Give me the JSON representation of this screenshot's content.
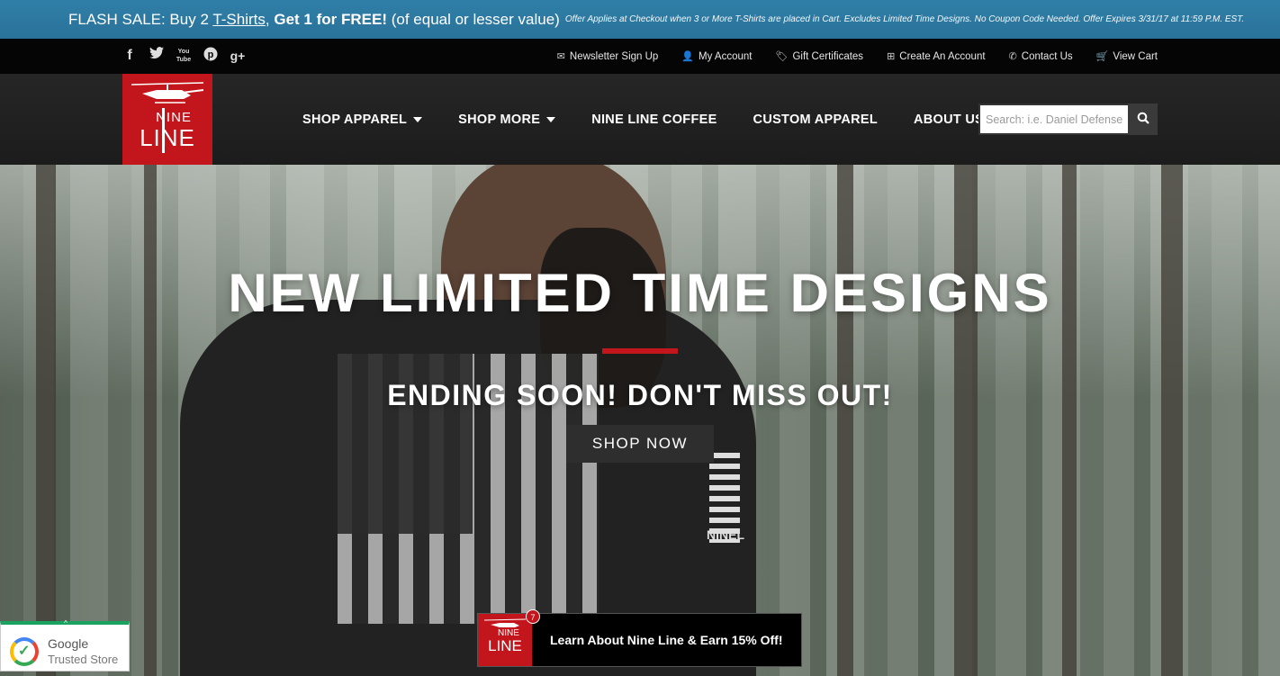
{
  "flash_banner": {
    "prefix": "FLASH SALE: Buy 2 ",
    "link": "T-Shirts",
    "comma": ",",
    "bold": "Get 1 for FREE!",
    "suffix": "(of equal or lesser value)",
    "fine_print": "Offer Applies at Checkout when 3 or More T-Shirts are placed in Cart. Excludes Limited Time Designs. No Coupon Code Needed. Offer Expires 3/31/17 at 11:59 P.M. EST."
  },
  "social": {
    "facebook": "f",
    "twitter": "t",
    "youtube": "You Tube",
    "pinterest": "p",
    "googleplus": "g+"
  },
  "utility_links": [
    {
      "label": "Newsletter Sign Up",
      "icon": "envelope-icon"
    },
    {
      "label": "My Account",
      "icon": "user-icon"
    },
    {
      "label": "Gift Certificates",
      "icon": "tag-icon"
    },
    {
      "label": "Create An Account",
      "icon": "plus-square-icon"
    },
    {
      "label": "Contact Us",
      "icon": "phone-icon"
    },
    {
      "label": "View Cart",
      "icon": "cart-icon"
    }
  ],
  "logo": {
    "line1": "NINE",
    "line2": "LINE"
  },
  "nav": [
    {
      "label": "SHOP APPAREL"
    },
    {
      "label": "SHOP MORE"
    },
    {
      "label": "NINE LINE COFFEE"
    },
    {
      "label": "CUSTOM APPAREL"
    },
    {
      "label": "ABOUT US"
    }
  ],
  "search": {
    "placeholder": "Search: i.e. Daniel Defense"
  },
  "hero": {
    "title": "NEW LIMITED TIME DESIGNS",
    "subtitle": "ENDING SOON! DON'T MISS OUT!",
    "button": "SHOP NOW",
    "sleeve_text": "NINEL"
  },
  "trusted_store": {
    "line1": "Google",
    "line2": "Trusted Store",
    "tab": "^"
  },
  "promo": {
    "logo_line1": "NINE",
    "logo_line2": "LINE",
    "badge_count": "7",
    "text": "Learn About Nine Line & Earn 15% Off!"
  },
  "colors": {
    "brand_red": "#c3161c",
    "banner_blue": "#2f7fa8",
    "header_dark": "#1c1c1c"
  }
}
